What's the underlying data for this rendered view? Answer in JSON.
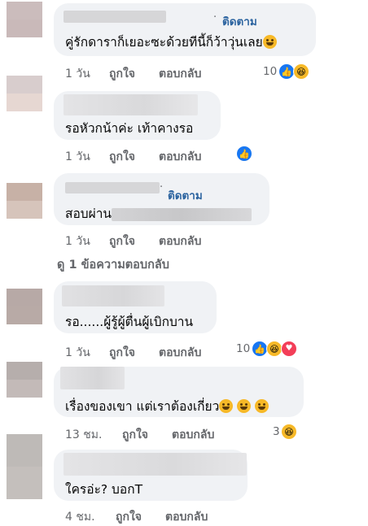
{
  "comments": [
    {
      "follow": "ติดตาม",
      "text": "คู่รักดาราก็เยอะซะด้วยทีนี้ก็ว้าวุ่นเลย",
      "time": "1 วัน",
      "like": "ถูกใจ",
      "reply": "ตอบกลับ",
      "reaction_count": "10",
      "reactions": [
        "like-icon",
        "haha-icon"
      ],
      "avatar_colors": [
        "#cbbcbc",
        "#c9b9b9"
      ]
    },
    {
      "text": "รอหัวกน้าค่ะ เท้าคางรอ",
      "time": "1 วัน",
      "like": "ถูกใจ",
      "reply": "ตอบกลับ",
      "reaction_count": "",
      "reactions": [
        "like-icon"
      ],
      "avatar_colors": [
        "#d8cdcd",
        "#e6d7d2"
      ]
    },
    {
      "follow": "ติดตาม",
      "text_prefix": "สอบผ่าน",
      "time": "1 วัน",
      "like": "ถูกใจ",
      "reply": "ตอบกลับ",
      "reaction_count": "",
      "reactions": [],
      "avatar_colors": [
        "#c7b1a6",
        "#d6c4bb"
      ]
    },
    {
      "text": "รอ......ผู้รู้ผู้ตื่นผู้เบิกบาน",
      "time": "1 วัน",
      "like": "ถูกใจ",
      "reply": "ตอบกลับ",
      "reaction_count": "10",
      "reactions": [
        "like-icon",
        "haha-icon",
        "love-icon"
      ],
      "avatar_colors": [
        "#b7a9a6",
        "#b8aaa6"
      ]
    },
    {
      "text": "เรื่องของเขา แต่เราต้องเกี่ยว",
      "time": "13 ชม.",
      "like": "ถูกใจ",
      "reply": "ตอบกลับ",
      "reaction_count": "3",
      "reactions": [
        "haha-icon"
      ],
      "avatar_colors": [
        "#b6aeac",
        "#c3bab8"
      ]
    },
    {
      "text": "ใครอ่ะ? บอกT",
      "time": "4 ชม.",
      "like": "ถูกใจ",
      "reply": "ตอบกลับ",
      "reaction_count": "",
      "reactions": [],
      "avatar_colors": [
        "#bebab7",
        "#c4bfbc"
      ]
    }
  ],
  "more_replies": "ดู 1 ข้อความตอบกลับ",
  "colors": {
    "bubble": "#f0f2f5",
    "follow": "#2c64a0",
    "meta": "#65676b",
    "like": "#1877f2",
    "haha": "#f7b928",
    "love": "#f33e58"
  }
}
